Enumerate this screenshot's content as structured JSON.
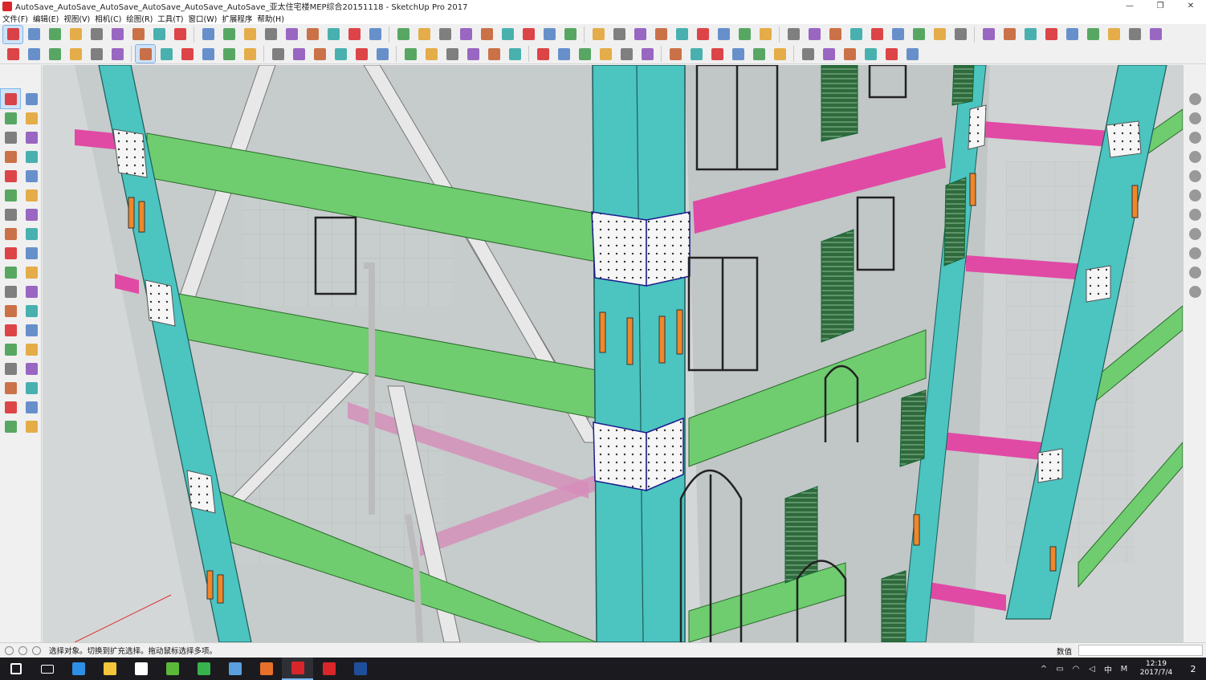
{
  "window": {
    "title": "AutoSave_AutoSave_AutoSave_AutoSave_AutoSave_AutoSave_亚太住宅楼MEP综合20151118 - SketchUp Pro 2017",
    "minimize_glyph": "—",
    "restore_glyph": "❐",
    "close_glyph": "✕"
  },
  "menu": {
    "items": [
      {
        "label": "文件(F)"
      },
      {
        "label": "编辑(E)"
      },
      {
        "label": "视图(V)"
      },
      {
        "label": "相机(C)"
      },
      {
        "label": "绘图(R)"
      },
      {
        "label": "工具(T)"
      },
      {
        "label": "窗口(W)"
      },
      {
        "label": "扩展程序"
      },
      {
        "label": "帮助(H)"
      }
    ]
  },
  "toolbar_row1": {
    "icons": [
      "select-icon",
      "eraser-icon",
      "pencil-icon",
      "arc-icon",
      "rectangle-icon",
      "push-pull-icon",
      "follow-me-icon",
      "move-icon",
      "rotate-icon",
      "scale-icon",
      "tape-measure-icon",
      "text-icon",
      "paint-bucket-icon",
      "orbit-icon",
      "pan-icon",
      "zoom-icon",
      "zoom-extents-icon",
      "warehouse-icon",
      "extension-warehouse-icon",
      "layout-icon",
      "ruby-icon",
      "iso-view-icon",
      "top-view-icon",
      "front-view-icon",
      "right-view-icon",
      "back-view-icon",
      "left-view-icon",
      "section-plane-icon",
      "section-display-icon",
      "shadow-icon",
      "fog-icon",
      "xray-icon",
      "wireframe-icon",
      "hidden-line-icon",
      "shaded-icon",
      "textured-icon",
      "monochrome-icon",
      "sandbox-icon",
      "drape-icon",
      "stamp-icon",
      "smoove-icon",
      "flip-icon",
      "solid-union-icon",
      "solid-subtract-icon",
      "trim-icon",
      "split-icon",
      "outer-shell-icon",
      "intersect-icon",
      "styles-icon",
      "geo-icon",
      "sun-icon",
      "scene-icon",
      "camera-icon",
      "light-icon"
    ]
  },
  "toolbar_row2": {
    "icons": [
      "component-icon",
      "group-icon",
      "material-icon",
      "layer-icon",
      "outliner-icon",
      "entity-info-icon",
      "cube-view-icon",
      "wall-icon",
      "floor-icon",
      "door-icon",
      "window-icon",
      "stair-icon",
      "roof-icon",
      "beam-icon",
      "column-icon",
      "duct-icon",
      "pipe-icon",
      "valve-icon",
      "fitting-icon",
      "tee-icon",
      "elbow-icon",
      "reducer-icon",
      "cable-tray-icon",
      "ifc-export-icon",
      "ifc-import-icon",
      "structure-icon",
      "tree-icon",
      "shrub-icon",
      "grass-icon",
      "flower-icon",
      "leaf-icon",
      "lamp-icon",
      "fan-icon",
      "pump-icon",
      "tank-icon",
      "sensor-icon",
      "magnify-icon",
      "filter-icon",
      "tag-icon",
      "warning-icon",
      "shield-icon",
      "badge-icon"
    ],
    "selected_index": 6
  },
  "left_toolbar": {
    "icons": [
      "select-icon",
      "make-component-icon",
      "paint-bucket-icon",
      "eraser-icon",
      "line-icon",
      "freehand-icon",
      "rectangle-icon",
      "rotated-rectangle-icon",
      "circle-icon",
      "polygon-icon",
      "arc-icon",
      "two-point-arc-icon",
      "three-point-arc-icon",
      "pie-icon",
      "move-icon",
      "push-pull-icon",
      "rotate-icon",
      "follow-me-icon",
      "scale-icon",
      "offset-icon",
      "tape-measure-icon",
      "dimension-icon",
      "protractor-icon",
      "text-icon",
      "axes-icon",
      "3d-text-icon",
      "orbit-icon",
      "pan-icon",
      "zoom-icon",
      "zoom-window-icon",
      "zoom-extents-icon",
      "previous-view-icon",
      "position-camera-icon",
      "look-around-icon",
      "walk-icon",
      "section-plane-icon"
    ],
    "selected_index": 0
  },
  "right_toolbar": {
    "icons": [
      "layers-icon",
      "dim-view-1-icon",
      "dim-view-2-icon",
      "dim-view-3-icon",
      "dim-view-4-icon",
      "check-icon",
      "orbit-small-icon",
      "walk-small-icon",
      "section-1-icon",
      "section-2-icon",
      "section-3-icon"
    ]
  },
  "status": {
    "text": "选择对象。切换到扩充选择。拖动鼠标选择多项。",
    "measure_label": "数值",
    "measure_value": ""
  },
  "taskbar": {
    "apps": [
      {
        "name": "start-icon",
        "color": "#ffffff"
      },
      {
        "name": "task-view-icon",
        "color": "#ffffff"
      },
      {
        "name": "edge-icon",
        "color": "#2d8fe6"
      },
      {
        "name": "file-explorer-icon",
        "color": "#f3c43c"
      },
      {
        "name": "store-icon",
        "color": "#ffffff"
      },
      {
        "name": "browser-360-icon",
        "color": "#5bb93a"
      },
      {
        "name": "video-player-icon",
        "color": "#37b24d"
      },
      {
        "name": "mail-icon",
        "color": "#5aa0de"
      },
      {
        "name": "firefox-icon",
        "color": "#e8702a"
      },
      {
        "name": "sketchup-icon",
        "color": "#d9262a"
      },
      {
        "name": "wps-icon",
        "color": "#d9262a"
      },
      {
        "name": "photoshop-icon",
        "color": "#1f4f9b"
      }
    ],
    "active_index": 9,
    "tray": {
      "icons": [
        "tray-up-icon",
        "tray-battery-icon",
        "tray-network-icon",
        "tray-volume-icon"
      ],
      "ime": "中",
      "ime_mode": "M",
      "time": "12:19",
      "date": "2017/7/4",
      "notification_count": "2"
    }
  },
  "colors": {
    "column": "#4cc4c0",
    "beam": "#6fcd6f",
    "duct": "#e04aa5",
    "plate": "#f7f7f7",
    "bolt_plate": "#f0872a",
    "louver": "#2f6a3c",
    "glass": "#b7c4c6"
  }
}
